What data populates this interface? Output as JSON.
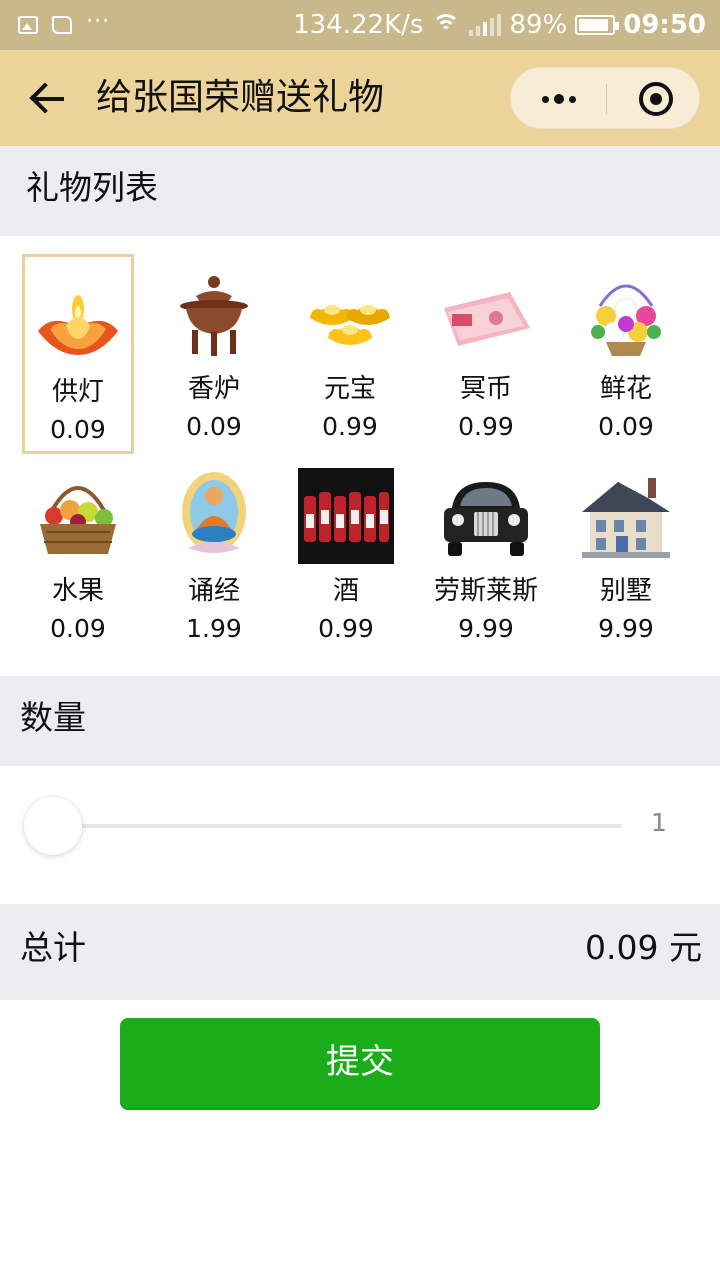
{
  "status_bar": {
    "net_speed": "134.22K/s",
    "battery_percent": "89%",
    "time": "09:50",
    "icons": [
      "image-icon",
      "book-icon",
      "more-dots-icon",
      "wifi-icon",
      "signal-icon",
      "battery-icon"
    ]
  },
  "nav": {
    "title": "给张国荣赠送礼物",
    "back_icon": "back-arrow-icon",
    "more_icon": "more-dots-icon",
    "close_icon": "target-close-icon",
    "bg_color": "#ecd39a"
  },
  "gifts_section": {
    "title": "礼物列表",
    "selected_index": 0,
    "items": [
      {
        "name": "供灯",
        "price": "0.09",
        "image": "lotus-lamp"
      },
      {
        "name": "香炉",
        "price": "0.09",
        "image": "incense-burner"
      },
      {
        "name": "元宝",
        "price": "0.99",
        "image": "gold-ingots"
      },
      {
        "name": "冥币",
        "price": "0.99",
        "image": "hell-money"
      },
      {
        "name": "鲜花",
        "price": "0.09",
        "image": "flower-basket"
      },
      {
        "name": "水果",
        "price": "0.09",
        "image": "fruit-basket"
      },
      {
        "name": "诵经",
        "price": "1.99",
        "image": "buddha"
      },
      {
        "name": "酒",
        "price": "0.99",
        "image": "liquor-bottles"
      },
      {
        "name": "劳斯莱斯",
        "price": "9.99",
        "image": "rolls-royce-car"
      },
      {
        "name": "别墅",
        "price": "9.99",
        "image": "villa"
      }
    ]
  },
  "quantity_section": {
    "title": "数量",
    "value": "1",
    "slider_fraction": 0
  },
  "total_section": {
    "label": "总计",
    "value": "0.09 元"
  },
  "submit": {
    "label": "提交",
    "color": "#1aad19"
  }
}
